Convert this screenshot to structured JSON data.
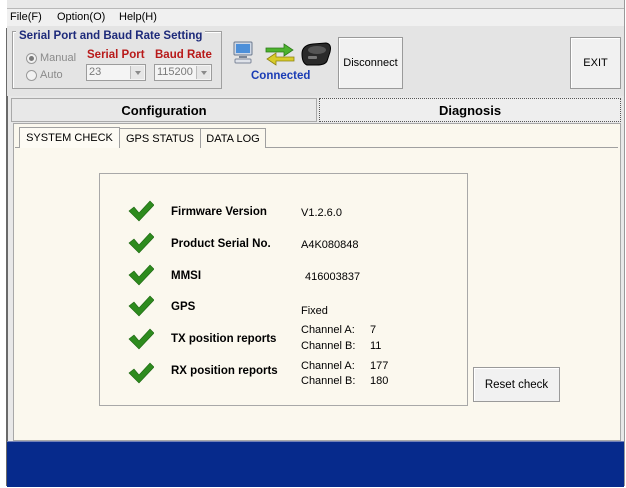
{
  "menu": [
    "File(F)",
    "Option(O)",
    "Help(H)"
  ],
  "serial_group": {
    "title": "Serial Port and Baud Rate Setting",
    "manual_label": "Manual",
    "auto_label": "Auto",
    "serial_port_label": "Serial Port",
    "baud_rate_label": "Baud Rate",
    "serial_port_value": "23",
    "baud_rate_value": "115200"
  },
  "connection": {
    "status": "Connected",
    "disconnect_label": "Disconnect",
    "exit_label": "EXIT"
  },
  "main_tabs": [
    "Configuration",
    "Diagnosis"
  ],
  "sub_tabs": [
    "SYSTEM CHECK",
    "GPS STATUS",
    "DATA LOG"
  ],
  "checks": [
    {
      "label": "Firmware Version",
      "value": "V1.2.6.0"
    },
    {
      "label": "Product Serial No.",
      "value": "A4K080848"
    },
    {
      "label": "MMSI",
      "value": "416003837"
    },
    {
      "label": "GPS",
      "value": "Fixed"
    },
    {
      "label": "TX position reports",
      "channel_a_label": "Channel A:",
      "channel_a": "7",
      "channel_b_label": "Channel B:",
      "channel_b": "11"
    },
    {
      "label": "RX position reports",
      "channel_a_label": "Channel A:",
      "channel_a": "177",
      "channel_b_label": "Channel B:",
      "channel_b": "180"
    }
  ],
  "reset_label": "Reset check",
  "colors": {
    "accent_blue": "#1a3cb5",
    "label_red": "#b81919",
    "panel_bg": "#fbf8ee",
    "status_bar": "#062a8c",
    "check_green": "#2e8b1e"
  }
}
